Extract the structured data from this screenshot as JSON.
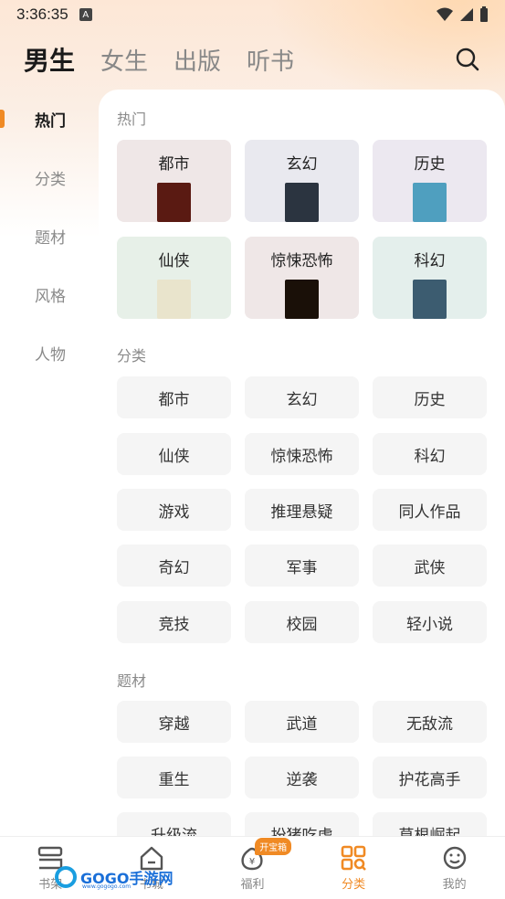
{
  "status": {
    "time": "3:36:35",
    "a_icon": "A"
  },
  "top_tabs": [
    "男生",
    "女生",
    "出版",
    "听书"
  ],
  "sidebar": [
    "热门",
    "分类",
    "题材",
    "风格",
    "人物"
  ],
  "sections": {
    "hot": "热门",
    "category": "分类",
    "theme": "题材"
  },
  "hot_cards": [
    {
      "label": "都市",
      "bg": "#efe7e7",
      "cover": "#5a1a12"
    },
    {
      "label": "玄幻",
      "bg": "#e9e9ef",
      "cover": "#2b3440"
    },
    {
      "label": "历史",
      "bg": "#ece8f0",
      "cover": "#4f9fbf"
    },
    {
      "label": "仙侠",
      "bg": "#e7f0e8",
      "cover": "#e9e4cc"
    },
    {
      "label": "惊悚恐怖",
      "bg": "#efe7e7",
      "cover": "#1a1008"
    },
    {
      "label": "科幻",
      "bg": "#e4efec",
      "cover": "#3c5c70"
    }
  ],
  "category_tags": [
    "都市",
    "玄幻",
    "历史",
    "仙侠",
    "惊悚恐怖",
    "科幻",
    "游戏",
    "推理悬疑",
    "同人作品",
    "奇幻",
    "军事",
    "武侠",
    "竞技",
    "校园",
    "轻小说"
  ],
  "theme_tags": [
    "穿越",
    "武道",
    "无敌流",
    "重生",
    "逆袭",
    "护花高手",
    "升级流",
    "扮猪吃虎",
    "草根崛起"
  ],
  "bottom_nav": [
    {
      "label": "书架",
      "icon": "bookshelf-icon"
    },
    {
      "label": "书城",
      "icon": "home-icon"
    },
    {
      "label": "福利",
      "icon": "money-bag-icon",
      "badge": "开宝箱"
    },
    {
      "label": "分类",
      "icon": "category-grid-icon",
      "active": true
    },
    {
      "label": "我的",
      "icon": "profile-icon"
    }
  ],
  "watermark": {
    "text": "GOGO手游网",
    "sub": "www.gogogo.com"
  },
  "colors": {
    "accent": "#f08a24"
  }
}
